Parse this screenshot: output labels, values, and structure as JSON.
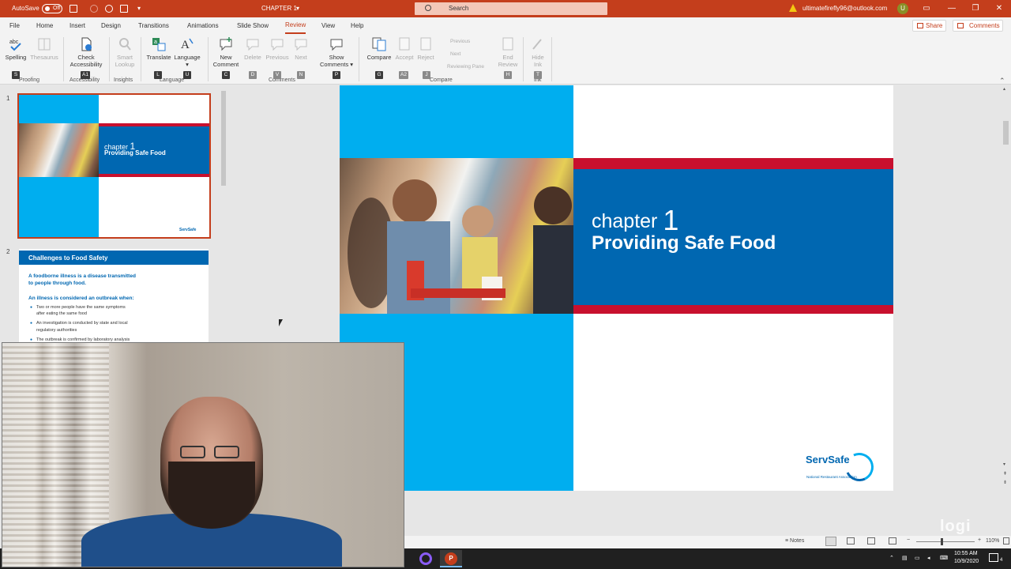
{
  "titlebar": {
    "autosave_label": "AutoSave",
    "autosave_state": "Off",
    "doc_title": "CHAPTER 1",
    "search_placeholder": "Search",
    "account": "ultimatefirefly96@outlook.com",
    "avatar": "U",
    "bg_color": "#c43e1c"
  },
  "tabs": [
    "File",
    "Home",
    "Insert",
    "Design",
    "Transitions",
    "Animations",
    "Slide Show",
    "Review",
    "View",
    "Help"
  ],
  "active_tab": "Review",
  "header_actions": {
    "share": "Share",
    "comments": "Comments"
  },
  "ribbon": {
    "spelling": "Spelling",
    "thesaurus": "Thesaurus",
    "check1": "Check",
    "check2": "Accessibility",
    "smart1": "Smart",
    "smart2": "Lookup",
    "translate": "Translate",
    "language": "Language",
    "new1": "New",
    "new2": "Comment",
    "delete": "Delete",
    "previous": "Previous",
    "next": "Next",
    "show1": "Show",
    "show2": "Comments",
    "compare": "Compare",
    "accept": "Accept",
    "reject": "Reject",
    "mini_previous": "Previous",
    "mini_next": "Next",
    "reviewing_pane": "Reviewing Pane",
    "end1": "End",
    "end2": "Review",
    "hide1": "Hide",
    "hide2": "Ink",
    "groups": {
      "proofing": "Proofing",
      "accessibility": "Accessibility",
      "insights": "Insights",
      "language": "Language",
      "comments": "Comments",
      "compare": "Compare",
      "ink": "Ink"
    },
    "keytips": [
      "S",
      "A1",
      "L",
      "U",
      "C",
      "D",
      "V",
      "N",
      "P",
      "G",
      "A2",
      "J",
      "H",
      "T"
    ]
  },
  "thumbnails": {
    "slide1_number": "1",
    "slide2_number": "2",
    "slide1": {
      "chapter": "chapter",
      "number": "1",
      "subtitle": "Providing Safe Food",
      "logo": "ServSafe"
    },
    "slide2": {
      "title": "Challenges to Food Safety",
      "def1": "A foodborne illness is a disease transmitted",
      "def2": "to people through food.",
      "outbreak": "An illness is considered an outbreak when:",
      "b1a": "Two or more people have the same symptoms",
      "b1b": "after eating the same food",
      "b2a": "An investigation is conducted by state and local",
      "b2b": "regulatory authorities",
      "b3": "The outbreak is confirmed by laboratory analysis"
    }
  },
  "slide": {
    "chapter_word": "chapter",
    "chapter_number": "1",
    "subtitle": "Providing Safe Food",
    "logo": "ServSafe",
    "logo_sub": "National Restaurant Association",
    "colors": {
      "sky": "#00aeef",
      "band": "#0067b1",
      "red": "#c8102e"
    }
  },
  "statusbar": {
    "notes": "Notes",
    "zoom": "110%"
  },
  "taskbar": {
    "time": "10:55 AM",
    "date": "10/9/2020",
    "notification_count": "4"
  },
  "watermark": "logi"
}
